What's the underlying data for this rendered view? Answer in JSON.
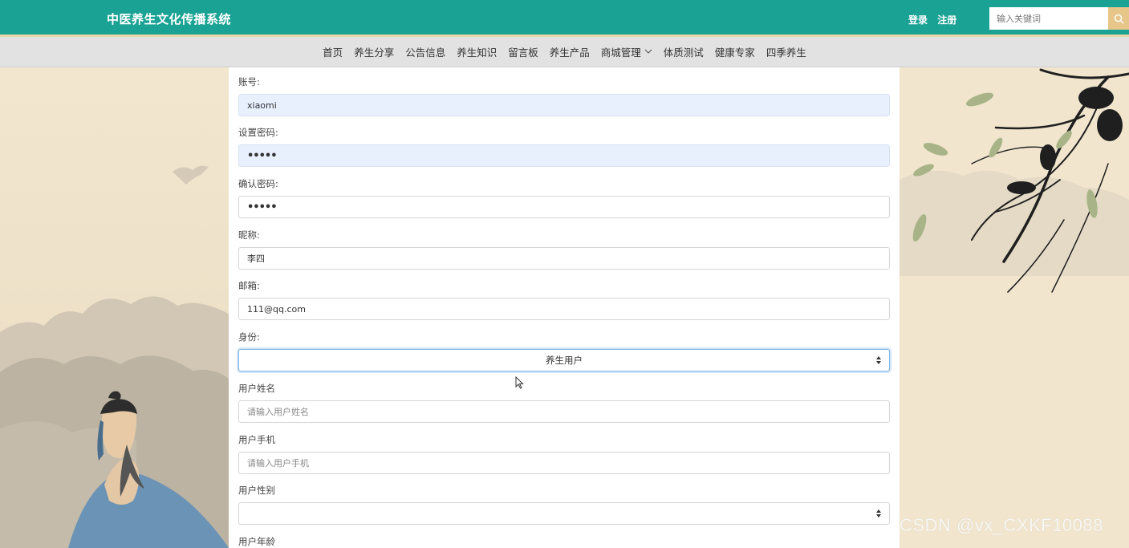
{
  "header": {
    "brand": "中医养生文化传播系统",
    "login": "登录",
    "register": "注册",
    "search_placeholder": "输入关键词",
    "search_icon": "search-icon"
  },
  "nav": {
    "items": [
      "首页",
      "养生分享",
      "公告信息",
      "养生知识",
      "留言板",
      "养生产品",
      "商城管理",
      "体质测试",
      "健康专家",
      "四季养生"
    ],
    "dropdown_icon": "chevron-down-icon"
  },
  "form": {
    "account": {
      "label": "账号:",
      "value": "xiaomi"
    },
    "password": {
      "label": "设置密码:",
      "value": "•••••"
    },
    "confirm": {
      "label": "确认密码:",
      "value": "•••••"
    },
    "nickname": {
      "label": "昵称:",
      "value": "李四"
    },
    "email": {
      "label": "邮箱:",
      "value": "111@qq.com"
    },
    "identity": {
      "label": "身份:",
      "value": "养生用户"
    },
    "realname": {
      "label": "用户姓名",
      "placeholder": "请输入用户姓名"
    },
    "phone": {
      "label": "用户手机",
      "placeholder": "请输入用户手机"
    },
    "gender": {
      "label": "用户性别",
      "value": ""
    },
    "age": {
      "label": "用户年龄"
    }
  },
  "watermark": "CSDN @vx_CXKF10088",
  "colors": {
    "header_bg": "#1aa394",
    "accent_gold": "#e7c689",
    "nav_bg": "#e2e2e2",
    "autofill_bg": "#e8f0fe"
  }
}
